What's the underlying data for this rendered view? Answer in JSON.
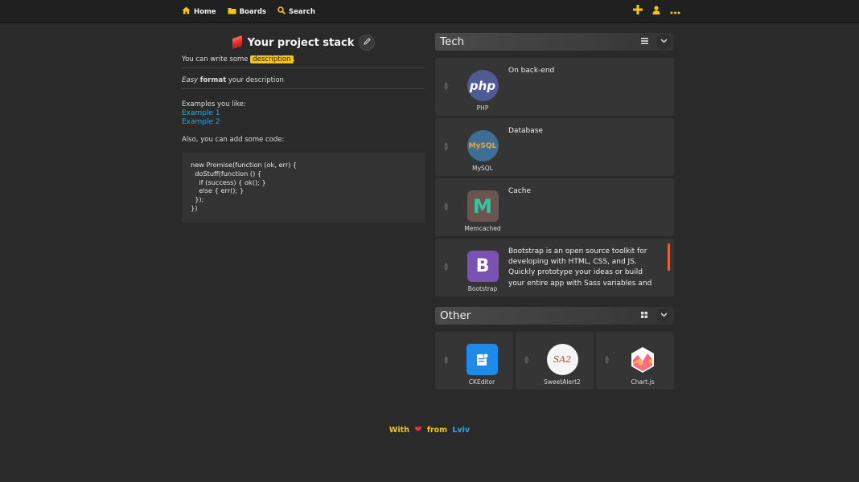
{
  "nav": {
    "items": [
      {
        "label": "Home",
        "icon": "home-icon"
      },
      {
        "label": "Boards",
        "icon": "folder-icon"
      },
      {
        "label": "Search",
        "icon": "search-icon"
      }
    ],
    "actions": [
      "plus-icon",
      "user-icon",
      "more-icon"
    ]
  },
  "project": {
    "title": "Your project stack",
    "desc_prefix": "You can write some ",
    "desc_highlight": "description",
    "desc_suffix": ".",
    "easy": "Easy",
    "format": "format",
    "format_rest": " your description",
    "examples_label": "Examples you like:",
    "example1": "Example 1",
    "example2": "Example 2",
    "code_label": "Also, you can add some code:",
    "code": "new Promise(function (ok, err) {\n  doStuff(function () {\n    if (success) { ok(); }\n    else { err(); }\n  });\n})"
  },
  "tech": {
    "title": "Tech",
    "cards": [
      {
        "name": "PHP",
        "logo_text": "php",
        "text": "On back-end"
      },
      {
        "name": "MySQL",
        "logo_text": "MySQL",
        "text": "Database"
      },
      {
        "name": "Memcached",
        "logo_text": "M",
        "text": "Cache"
      },
      {
        "name": "Bootstrap",
        "logo_text": "B",
        "text": "Bootstrap is an open source toolkit for developing with HTML, CSS, and JS. Quickly prototype your ideas or build your entire app with Sass variables and"
      }
    ]
  },
  "other": {
    "title": "Other",
    "cards": [
      {
        "name": "CKEditor"
      },
      {
        "name": "SweetAlert2",
        "logo_text": "SA2"
      },
      {
        "name": "Chart.js"
      }
    ]
  },
  "footer": {
    "with": "With",
    "from": "from",
    "city": "Lviv"
  },
  "colors": {
    "accent": "#f5c518",
    "link": "#2aa6e0",
    "heart": "#e53935"
  }
}
